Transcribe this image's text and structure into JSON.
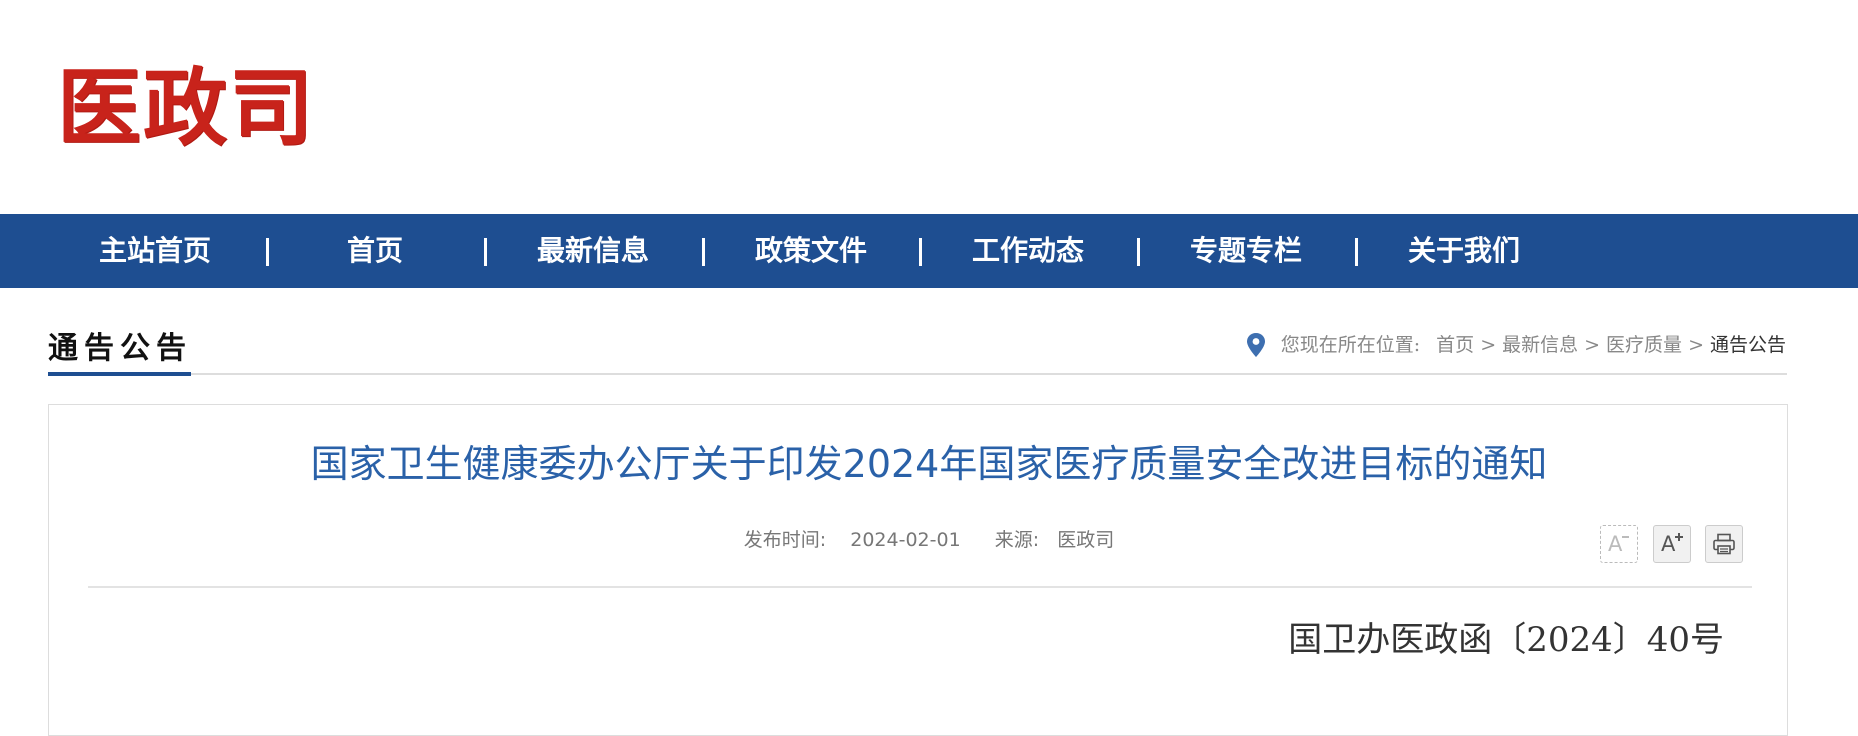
{
  "header": {
    "logo_text": "医政司"
  },
  "nav": {
    "items": [
      {
        "label": "主站首页"
      },
      {
        "label": "首页"
      },
      {
        "label": "最新信息"
      },
      {
        "label": "政策文件"
      },
      {
        "label": "工作动态"
      },
      {
        "label": "专题专栏"
      },
      {
        "label": "关于我们"
      }
    ]
  },
  "section": {
    "title": "通告公告"
  },
  "breadcrumb": {
    "prefix": "您现在所在位置:",
    "items": [
      {
        "label": "首页"
      },
      {
        "label": "最新信息"
      },
      {
        "label": "医疗质量"
      },
      {
        "label": "通告公告"
      }
    ],
    "separator": ">"
  },
  "article": {
    "title": "国家卫生健康委办公厅关于印发2024年国家医疗质量安全改进目标的通知",
    "published_label": "发布时间:",
    "published_date": "2024-02-01",
    "source_label": "来源:",
    "source": "医政司",
    "doc_number": "国卫办医政函〔2024〕40号"
  },
  "tools": {
    "font_decrease": "A",
    "font_increase": "A"
  },
  "colors": {
    "brand_red": "#c8231b",
    "nav_blue": "#1e4e91",
    "title_blue": "#2a61a8"
  }
}
